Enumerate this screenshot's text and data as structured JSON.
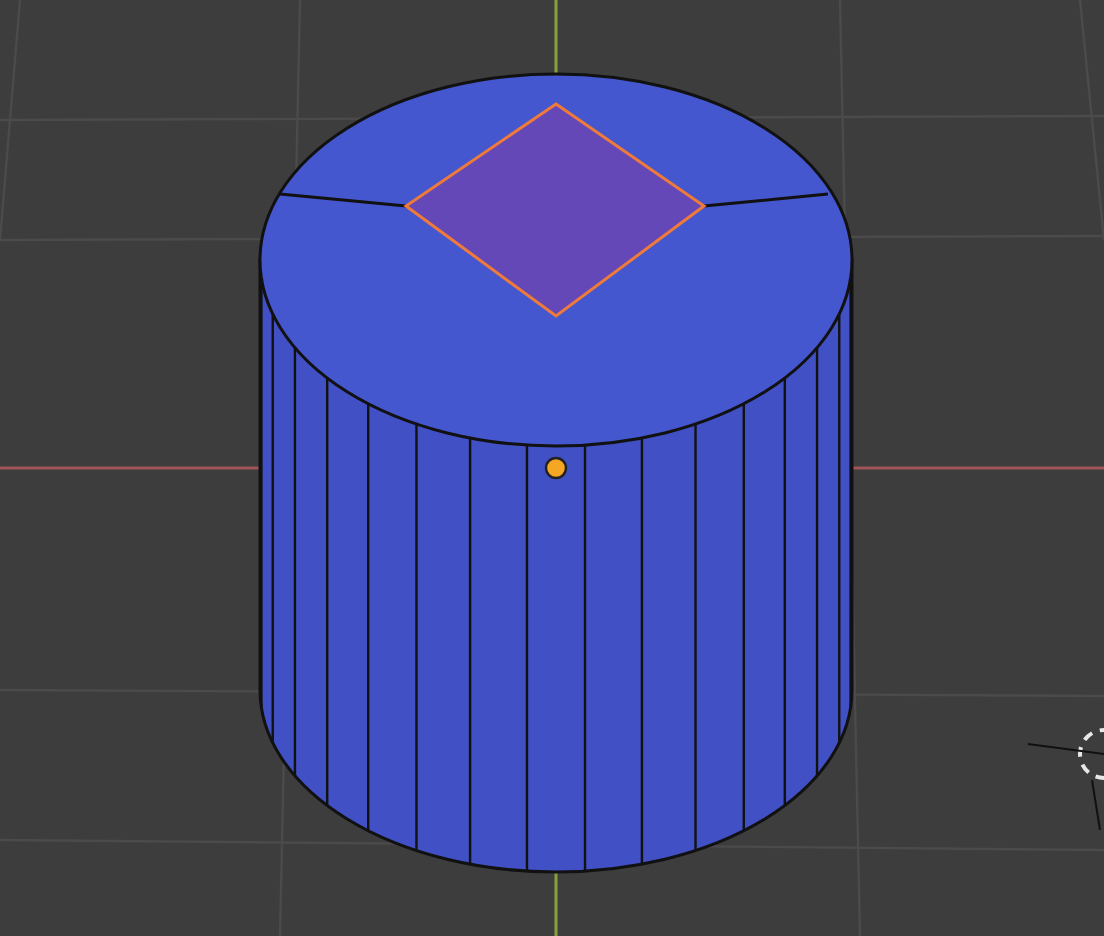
{
  "viewport": {
    "selected_face": true
  }
}
